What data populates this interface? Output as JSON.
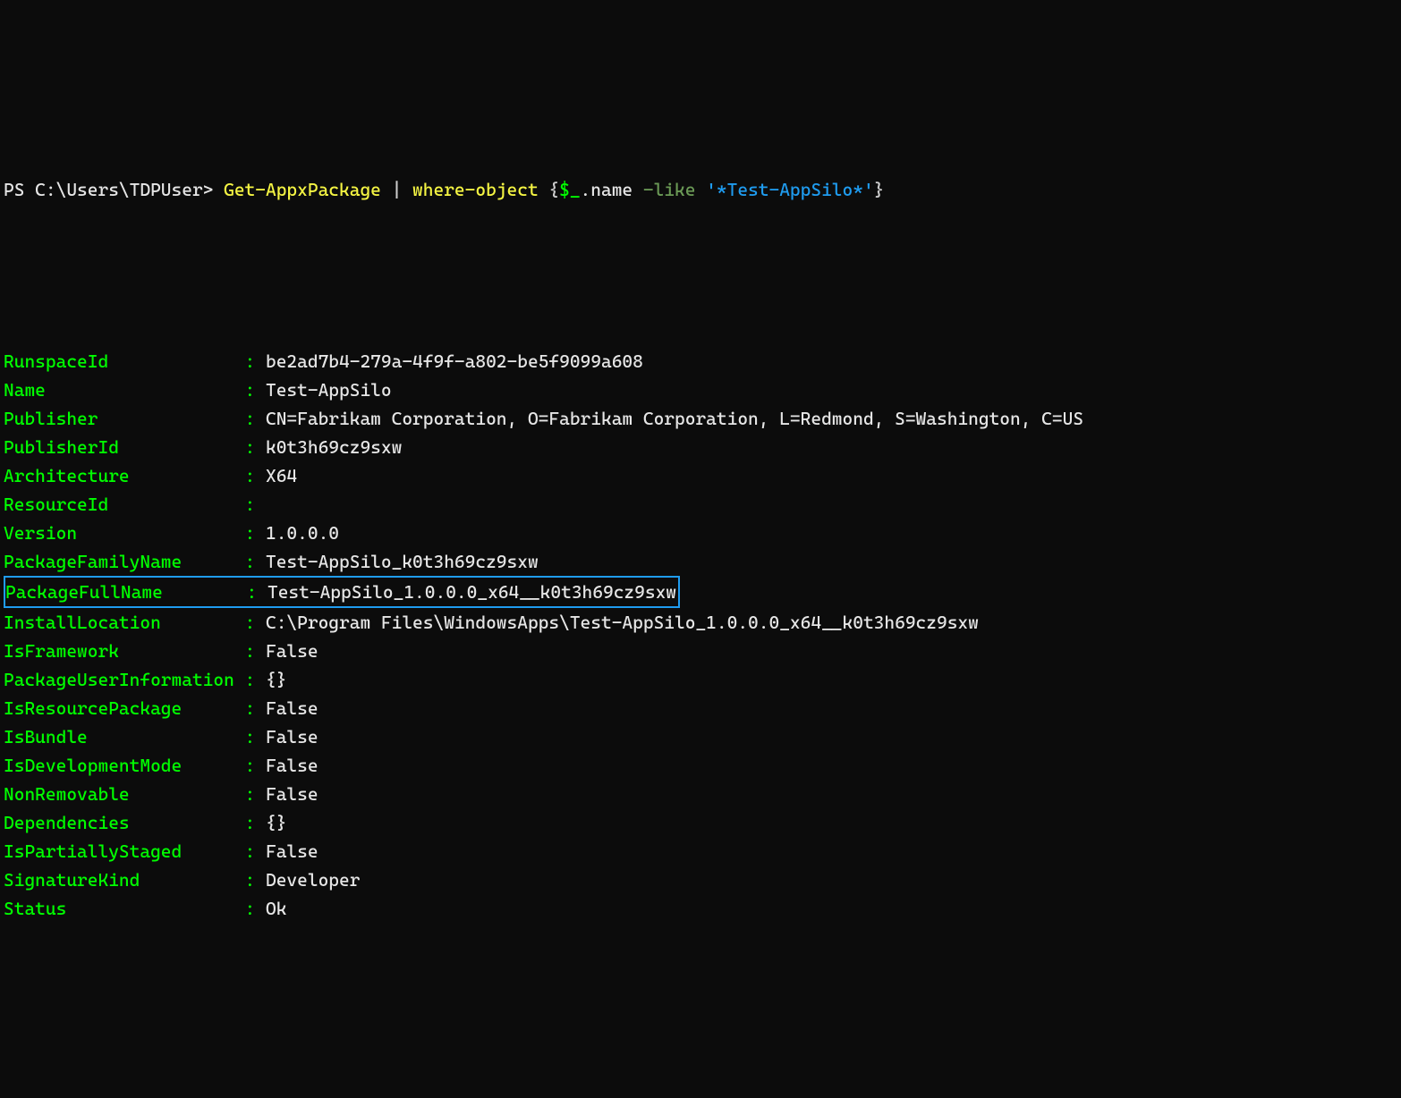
{
  "prompt": {
    "prefix": "PS C:\\Users\\TDPUser> ",
    "cmdlet": "Get-AppxPackage",
    "pipe": " | ",
    "where": "where-object",
    "space": " ",
    "lbrace": "{",
    "autovar": "$_",
    "member": ".name ",
    "likeop": "-like ",
    "strlit": "'*Test-AppSilo*'",
    "rbrace": "}"
  },
  "fields": [
    {
      "key": "RunspaceId",
      "value": "be2ad7b4-279a-4f9f-a802-be5f9099a608"
    },
    {
      "key": "Name",
      "value": "Test-AppSilo"
    },
    {
      "key": "Publisher",
      "value": "CN=Fabrikam Corporation, O=Fabrikam Corporation, L=Redmond, S=Washington, C=US"
    },
    {
      "key": "PublisherId",
      "value": "k0t3h69cz9sxw"
    },
    {
      "key": "Architecture",
      "value": "X64"
    },
    {
      "key": "ResourceId",
      "value": ""
    },
    {
      "key": "Version",
      "value": "1.0.0.0"
    },
    {
      "key": "PackageFamilyName",
      "value": "Test-AppSilo_k0t3h69cz9sxw"
    },
    {
      "key": "PackageFullName",
      "value": "Test-AppSilo_1.0.0.0_x64__k0t3h69cz9sxw",
      "highlight": true
    },
    {
      "key": "InstallLocation",
      "value": "C:\\Program Files\\WindowsApps\\Test-AppSilo_1.0.0.0_x64__k0t3h69cz9sxw"
    },
    {
      "key": "IsFramework",
      "value": "False"
    },
    {
      "key": "PackageUserInformation",
      "value": "{}"
    },
    {
      "key": "IsResourcePackage",
      "value": "False"
    },
    {
      "key": "IsBundle",
      "value": "False"
    },
    {
      "key": "IsDevelopmentMode",
      "value": "False"
    },
    {
      "key": "NonRemovable",
      "value": "False"
    },
    {
      "key": "Dependencies",
      "value": "{}"
    },
    {
      "key": "IsPartiallyStaged",
      "value": "False"
    },
    {
      "key": "SignatureKind",
      "value": "Developer"
    },
    {
      "key": "Status",
      "value": "Ok"
    }
  ],
  "keyWidth": 23
}
